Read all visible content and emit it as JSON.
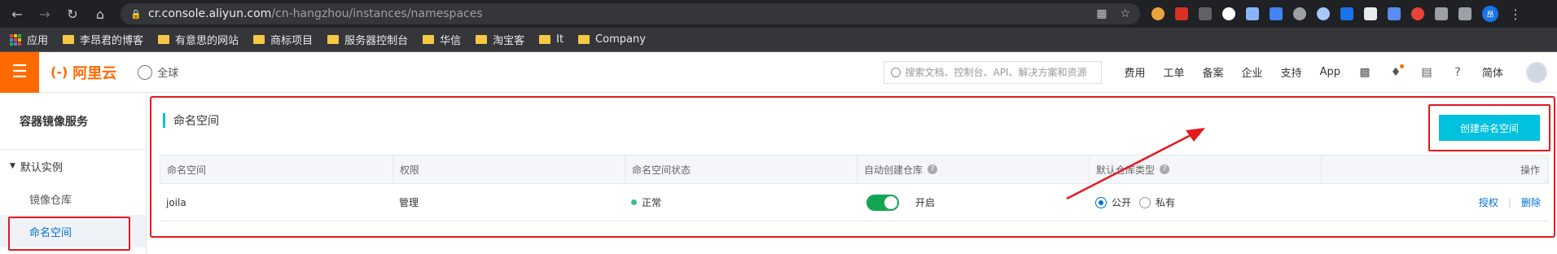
{
  "browser": {
    "url_host": "cr.console.aliyun.com",
    "url_path": "/cn-hangzhou/instances/namespaces",
    "bookmarks": [
      "应用",
      "李昂君的博客",
      "有意思的网站",
      "商标项目",
      "服务器控制台",
      "华信",
      "淘宝客",
      "It",
      "Company"
    ],
    "profile_initial": "昂"
  },
  "header": {
    "logo_text": "阿里云",
    "region": "全球",
    "search_placeholder": "搜索文档、控制台、API、解决方案和资源",
    "links": [
      "费用",
      "工单",
      "备案",
      "企业",
      "支持",
      "App"
    ],
    "lang": "简体"
  },
  "sidebar": {
    "title": "容器镜像服务",
    "group": "默认实例",
    "items": [
      {
        "label": "镜像仓库"
      },
      {
        "label": "命名空间"
      }
    ]
  },
  "main": {
    "section_title": "命名空间",
    "create_button": "创建命名空间",
    "table": {
      "headers": [
        "命名空间",
        "权限",
        "命名空间状态",
        "自动创建仓库",
        "默认仓库类型",
        "操作"
      ],
      "rows": [
        {
          "name": "joila",
          "permission": "管理",
          "status": "正常",
          "auto_create": "开启",
          "repo_type_public": "公开",
          "repo_type_private": "私有",
          "op_authorize": "授权",
          "op_delete": "删除"
        }
      ]
    }
  },
  "colors": {
    "accent": "#ff6a00",
    "primary": "#00c1de",
    "link": "#0070cc",
    "annotation": "#e5191f"
  }
}
